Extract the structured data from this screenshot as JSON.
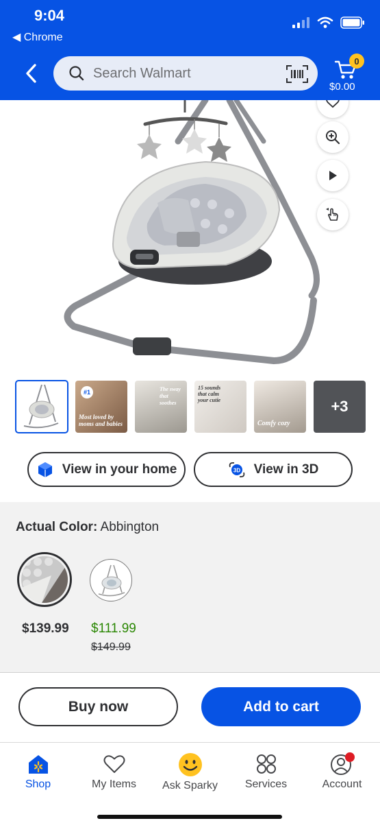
{
  "status_bar": {
    "time": "9:04",
    "back_app": "◀ Chrome"
  },
  "header": {
    "search_placeholder": "Search Walmart",
    "cart_count": "0",
    "cart_total": "$0.00",
    "brand_color": "#0753e4"
  },
  "gallery": {
    "thumbnails": [
      {
        "caption": ""
      },
      {
        "caption": "Most loved by moms and babies"
      },
      {
        "caption": "The sway that soothes"
      },
      {
        "caption": "15 sounds that calm your cutie"
      },
      {
        "caption": "Comfy cozy"
      },
      {
        "caption": "+3"
      }
    ]
  },
  "actions": {
    "view_home": "View in your home",
    "view_3d": "View in 3D"
  },
  "variant": {
    "label": "Actual Color:",
    "value": "Abbington",
    "options": [
      {
        "price": "$139.99"
      },
      {
        "price": "$111.99",
        "was_price": "$149.99",
        "price_color": "#2a8703"
      }
    ]
  },
  "buttons": {
    "buy_now": "Buy now",
    "add_to_cart": "Add to cart"
  },
  "bottom_nav": {
    "items": [
      {
        "label": "Shop",
        "icon": "spark-home-icon"
      },
      {
        "label": "My Items",
        "icon": "heart-icon"
      },
      {
        "label": "Ask Sparky",
        "icon": "smiley-icon"
      },
      {
        "label": "Services",
        "icon": "grid-circles-icon"
      },
      {
        "label": "Account",
        "icon": "person-icon"
      }
    ]
  }
}
